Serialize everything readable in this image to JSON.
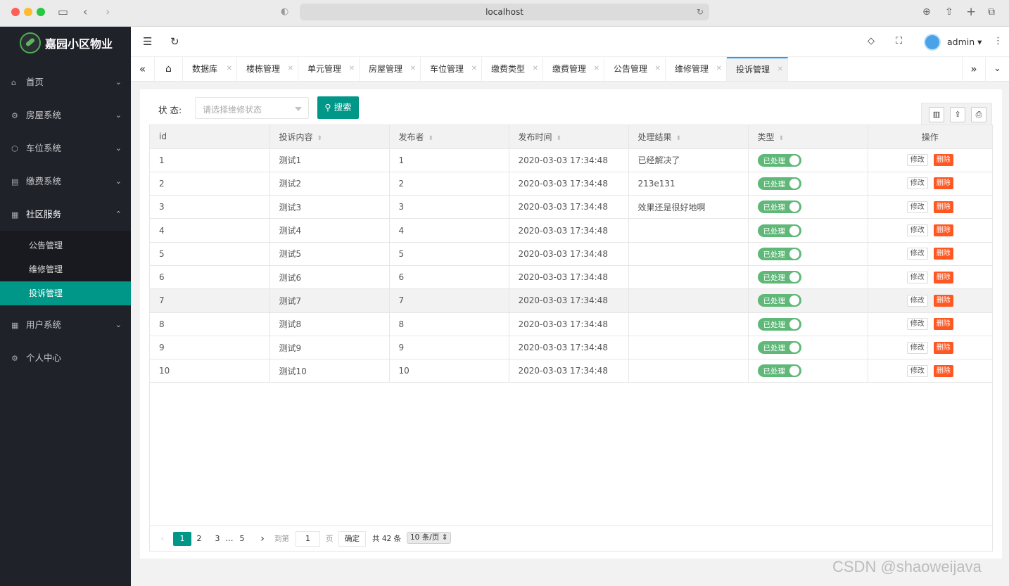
{
  "browser": {
    "url": "localhost"
  },
  "app": {
    "title": "嘉园小区物业",
    "user": "admin"
  },
  "sidebar": {
    "items": [
      {
        "label": "首页",
        "icon": "home-icon",
        "chevron": "chevron-down"
      },
      {
        "label": "房屋系统",
        "icon": "gear-icon",
        "chevron": "chevron-down"
      },
      {
        "label": "车位系统",
        "icon": "cube-icon",
        "chevron": "chevron-down"
      },
      {
        "label": "缴费系统",
        "icon": "wallet-icon",
        "chevron": "chevron-down"
      },
      {
        "label": "社区服务",
        "icon": "apps-icon",
        "chevron": "chevron-up"
      },
      {
        "label": "用户系统",
        "icon": "apps-icon",
        "chevron": "chevron-down"
      },
      {
        "label": "个人中心",
        "icon": "gear-icon",
        "chevron": ""
      }
    ],
    "sub_items": [
      "公告管理",
      "维修管理",
      "投诉管理"
    ]
  },
  "tabs": [
    "数据库",
    "楼栋管理",
    "单元管理",
    "房屋管理",
    "车位管理",
    "缴费类型",
    "缴费管理",
    "公告管理",
    "维修管理",
    "投诉管理"
  ],
  "filter": {
    "label": "状 态:",
    "placeholder": "请选择维修状态",
    "search_label": "搜索"
  },
  "table": {
    "columns": [
      "id",
      "投诉内容",
      "发布者",
      "发布时间",
      "处理结果",
      "类型",
      "操作"
    ],
    "rows": [
      {
        "id": "1",
        "content": "测试1",
        "publisher": "1",
        "time": "2020-03-03 17:34:48",
        "result": "已经解决了",
        "type": "已处理"
      },
      {
        "id": "2",
        "content": "测试2",
        "publisher": "2",
        "time": "2020-03-03 17:34:48",
        "result": "213e131",
        "type": "已处理"
      },
      {
        "id": "3",
        "content": "测试3",
        "publisher": "3",
        "time": "2020-03-03 17:34:48",
        "result": "效果还是很好地啊",
        "type": "已处理"
      },
      {
        "id": "4",
        "content": "测试4",
        "publisher": "4",
        "time": "2020-03-03 17:34:48",
        "result": "",
        "type": "已处理"
      },
      {
        "id": "5",
        "content": "测试5",
        "publisher": "5",
        "time": "2020-03-03 17:34:48",
        "result": "",
        "type": "已处理"
      },
      {
        "id": "6",
        "content": "测试6",
        "publisher": "6",
        "time": "2020-03-03 17:34:48",
        "result": "",
        "type": "已处理"
      },
      {
        "id": "7",
        "content": "测试7",
        "publisher": "7",
        "time": "2020-03-03 17:34:48",
        "result": "",
        "type": "已处理"
      },
      {
        "id": "8",
        "content": "测试8",
        "publisher": "8",
        "time": "2020-03-03 17:34:48",
        "result": "",
        "type": "已处理"
      },
      {
        "id": "9",
        "content": "测试9",
        "publisher": "9",
        "time": "2020-03-03 17:34:48",
        "result": "",
        "type": "已处理"
      },
      {
        "id": "10",
        "content": "测试10",
        "publisher": "10",
        "time": "2020-03-03 17:34:48",
        "result": "",
        "type": "已处理"
      }
    ],
    "edit_label": "修改",
    "delete_label": "删除"
  },
  "pager": {
    "pages": [
      "1",
      "2",
      "3",
      "…",
      "5"
    ],
    "goto_label": "到第",
    "goto_value": "1",
    "page_unit": "页",
    "confirm_label": "确定",
    "total_label": "共 42 条",
    "page_size_label": "10 条/页"
  },
  "watermark": "CSDN @shaoweijava",
  "colors": {
    "primary": "#009688",
    "sidebar": "#20222a",
    "danger": "#ff5722",
    "switch_on": "#5fb878"
  }
}
